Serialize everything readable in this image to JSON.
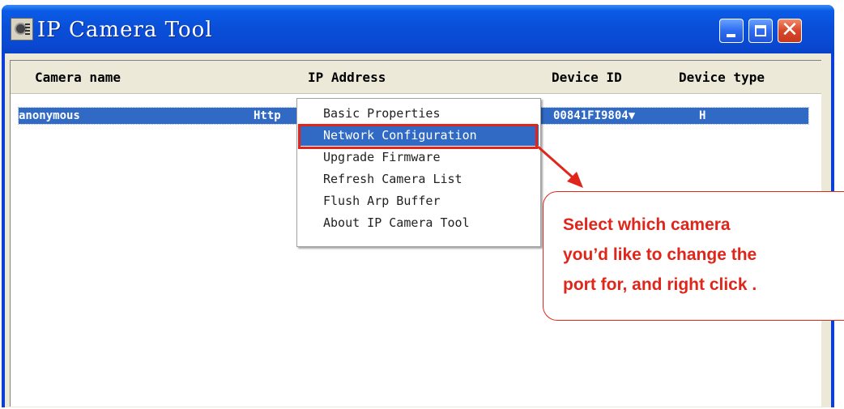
{
  "window": {
    "title": "IP Camera Tool"
  },
  "columns": [
    "Camera name",
    "IP Address",
    "Device ID",
    "Device type"
  ],
  "rows": [
    {
      "camera_name": "anonymous",
      "ip_address": "Http",
      "device_id": "00841FI9804▼",
      "device_type": "H"
    }
  ],
  "context_menu": {
    "items": [
      {
        "label": "Basic Properties"
      },
      {
        "label": "Network Configuration",
        "selected": true
      },
      {
        "label": "Upgrade Firmware"
      },
      {
        "label": "Refresh Camera List"
      },
      {
        "label": "Flush Arp Buffer"
      },
      {
        "label": "About IP Camera Tool"
      }
    ]
  },
  "callout": {
    "lines": [
      "Select which camera",
      "you’d like to change the",
      "port for, and right click ."
    ]
  },
  "colors": {
    "titlebar_blue": "#0a4fd8",
    "selection_blue": "#316ac5",
    "annotation_red": "#e0251b",
    "close_button": "#d9462a"
  }
}
